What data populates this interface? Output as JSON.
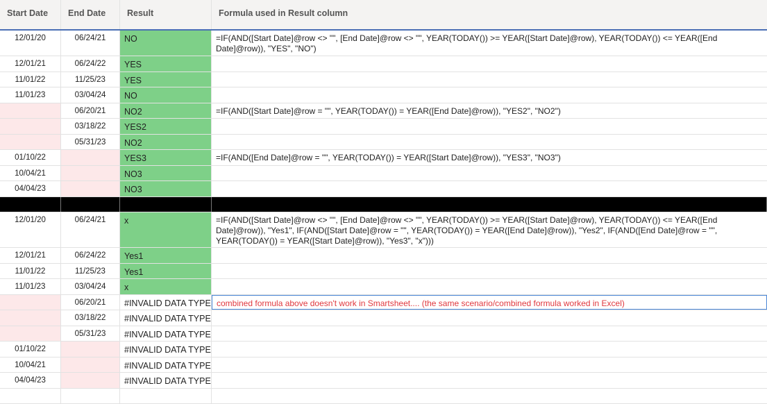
{
  "columns": {
    "start": "Start Date",
    "end": "End Date",
    "result": "Result",
    "formula": "Formula used in Result column"
  },
  "colors": {
    "green": "#7ed088",
    "pink": "#fde8e9",
    "note": "#e0383e"
  },
  "rows": [
    {
      "start": "12/01/20",
      "end": "06/24/21",
      "result": "NO",
      "green": true,
      "h": 37,
      "formula": "=IF(AND([Start Date]@row <> \"\", [End Date]@row <> \"\", YEAR(TODAY()) >= YEAR([Start Date]@row), YEAR(TODAY()) <= YEAR([End Date]@row)), \"YES\", \"NO\")"
    },
    {
      "start": "12/01/21",
      "end": "06/24/22",
      "result": "YES",
      "green": true
    },
    {
      "start": "11/01/22",
      "end": "11/25/23",
      "result": "YES",
      "green": true
    },
    {
      "start": "11/01/23",
      "end": "03/04/24",
      "result": "NO",
      "green": true
    },
    {
      "start": "",
      "end": "06/20/21",
      "result": "NO2",
      "green": true,
      "pinkStart": true,
      "formula": "=IF(AND([Start Date]@row = \"\", YEAR(TODAY()) = YEAR([End Date]@row)), \"YES2\", \"NO2\")"
    },
    {
      "start": "",
      "end": "03/18/22",
      "result": "YES2",
      "green": true,
      "pinkStart": true
    },
    {
      "start": "",
      "end": "05/31/23",
      "result": "NO2",
      "green": true,
      "pinkStart": true
    },
    {
      "start": "01/10/22",
      "end": "",
      "result": "YES3",
      "green": true,
      "pinkEnd": true,
      "formula": "=IF(AND([End Date]@row = \"\", YEAR(TODAY()) = YEAR([Start Date]@row)), \"YES3\", \"NO3\")"
    },
    {
      "start": "10/04/21",
      "end": "",
      "result": "NO3",
      "green": true,
      "pinkEnd": true
    },
    {
      "start": "04/04/23",
      "end": "",
      "result": "NO3",
      "green": true,
      "pinkEnd": true
    },
    {
      "separator": true
    },
    {
      "start": "12/01/20",
      "end": "06/24/21",
      "result": "x",
      "green": true,
      "h": 51,
      "formula": "=IF(AND([Start Date]@row <> \"\", [End Date]@row <> \"\", YEAR(TODAY()) >= YEAR([Start Date]@row), YEAR(TODAY()) <= YEAR([End Date]@row)), \"Yes1\", IF(AND([Start Date]@row = \"\", YEAR(TODAY()) = YEAR([End Date]@row)), \"Yes2\", IF(AND([End Date]@row = \"\", YEAR(TODAY()) = YEAR([Start Date]@row)), \"Yes3\", \"x\")))"
    },
    {
      "start": "12/01/21",
      "end": "06/24/22",
      "result": "Yes1",
      "green": true
    },
    {
      "start": "11/01/22",
      "end": "11/25/23",
      "result": "Yes1",
      "green": true
    },
    {
      "start": "11/01/23",
      "end": "03/04/24",
      "result": "x",
      "green": true
    },
    {
      "start": "",
      "end": "06/20/21",
      "result": "#INVALID DATA TYPE",
      "pinkStart": true,
      "note": true,
      "formula": "combined formula above doesn't work in Smartsheet.... (the same scenario/combined formula worked in Excel)"
    },
    {
      "start": "",
      "end": "03/18/22",
      "result": "#INVALID DATA TYPE",
      "pinkStart": true
    },
    {
      "start": "",
      "end": "05/31/23",
      "result": "#INVALID DATA TYPE",
      "pinkStart": true
    },
    {
      "start": "01/10/22",
      "end": "",
      "result": "#INVALID DATA TYPE",
      "pinkEnd": true
    },
    {
      "start": "10/04/21",
      "end": "",
      "result": "#INVALID DATA TYPE",
      "pinkEnd": true
    },
    {
      "start": "04/04/23",
      "end": "",
      "result": "#INVALID DATA TYPE",
      "pinkEnd": true
    },
    {
      "start": "",
      "end": "",
      "result": ""
    }
  ]
}
